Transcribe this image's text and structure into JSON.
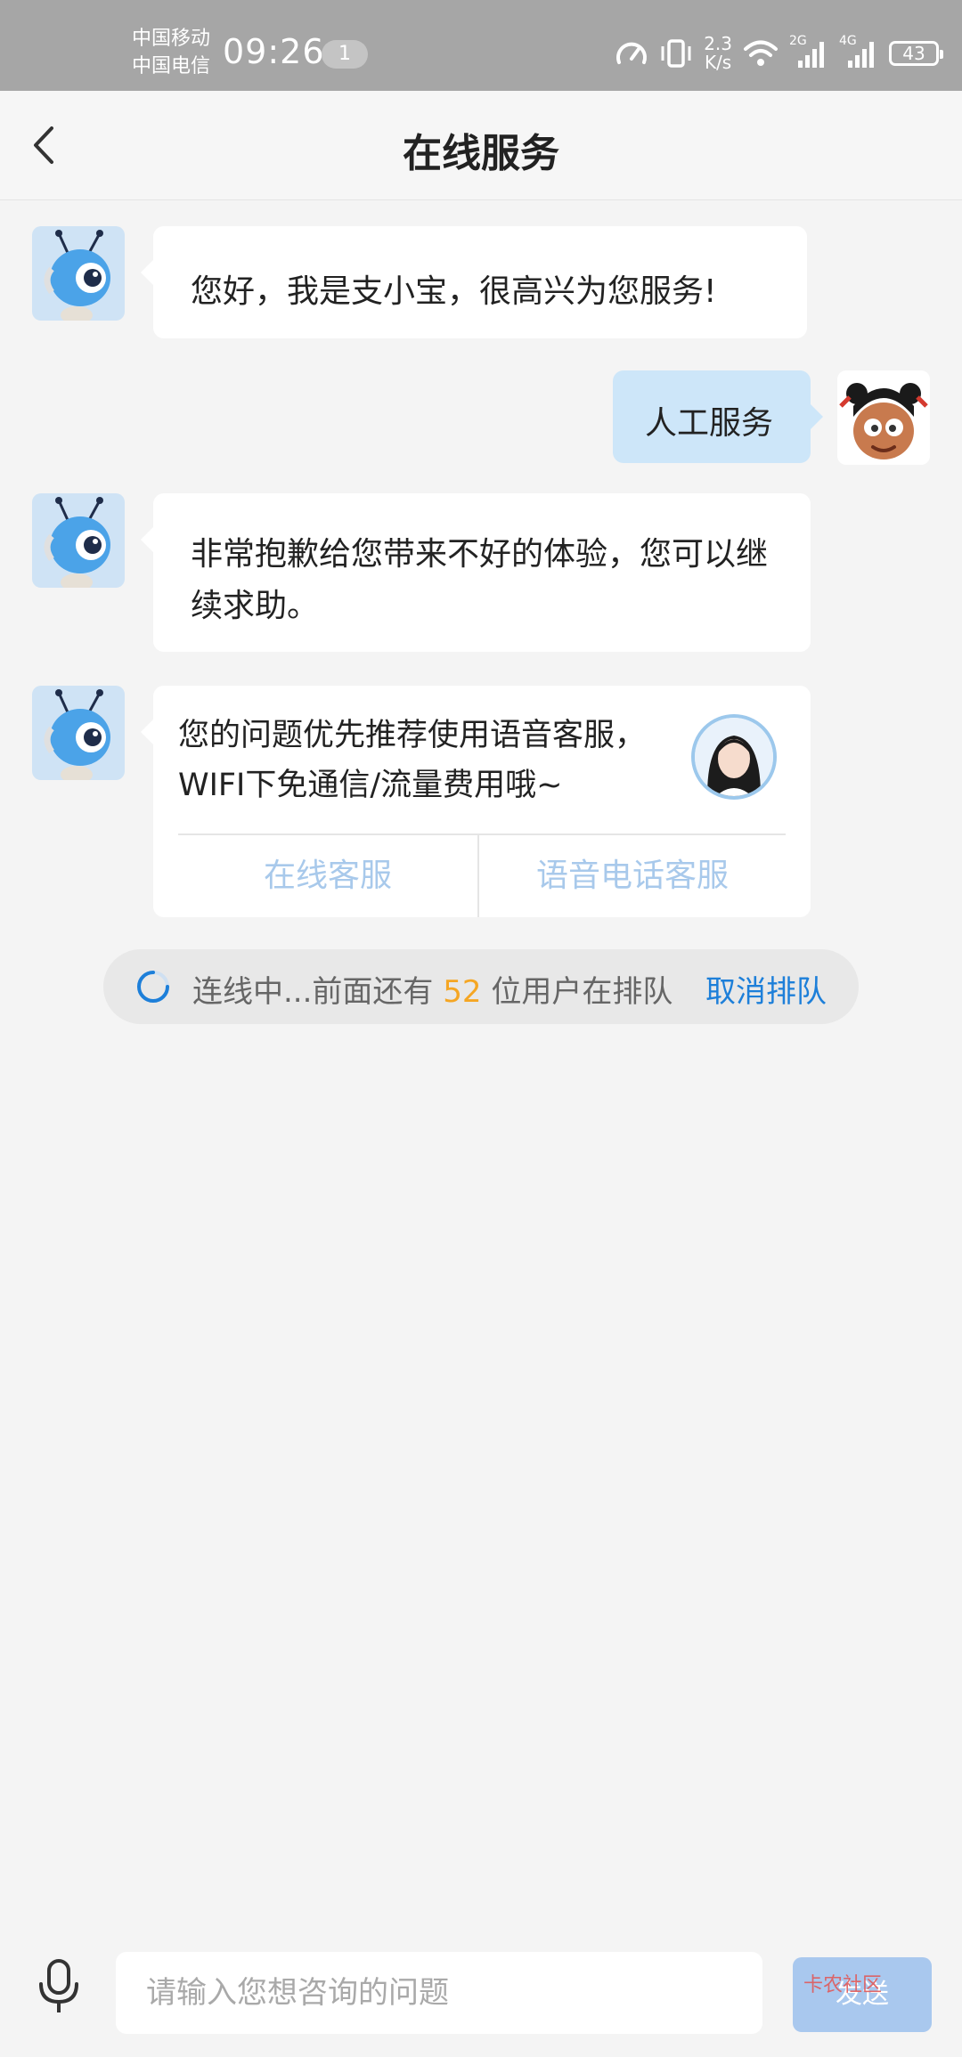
{
  "status_bar": {
    "carrier_1": "中国移动",
    "carrier_2": "中国电信",
    "time": "09:26",
    "notification_count": "1",
    "net_speed_value": "2.3",
    "net_speed_unit": "K/s",
    "signal_1_label": "2G",
    "signal_2_label": "4G",
    "battery": "43"
  },
  "header": {
    "title": "在线服务",
    "back_icon": "chevron-left-icon"
  },
  "messages": [
    {
      "side": "left",
      "avatar_icon": "robot-mascot-icon",
      "text": "您好，我是支小宝，很高兴为您服务!"
    },
    {
      "side": "right",
      "avatar_icon": "user-cartoon-avatar",
      "text": "人工服务"
    },
    {
      "side": "left",
      "avatar_icon": "robot-mascot-icon",
      "text": "非常抱歉给您带来不好的体验，您可以继续求助。"
    },
    {
      "side": "left",
      "avatar_icon": "robot-mascot-icon",
      "text": "您的问题优先推荐使用语音客服，WIFI下免通信/流量费用哦~",
      "agent_photo_icon": "agent-photo-avatar",
      "options": [
        "在线客服",
        "语音电话客服"
      ]
    }
  ],
  "queue": {
    "prefix": "连线中...前面还有",
    "count": "52",
    "suffix": "位用户在排队",
    "cancel_label": "取消排队"
  },
  "input_bar": {
    "mic_icon": "microphone-icon",
    "placeholder": "请输入您想咨询的问题",
    "send_label": "发送",
    "watermark": "卡农社区"
  },
  "colors": {
    "status_bar_bg": "#a6a6a6",
    "page_bg": "#f4f4f4",
    "user_bubble": "#cde6f9",
    "link_blue": "#1d7fd9",
    "queue_number": "#f5a623",
    "option_text": "#a8c9eb",
    "send_button": "#a9c8ee"
  }
}
